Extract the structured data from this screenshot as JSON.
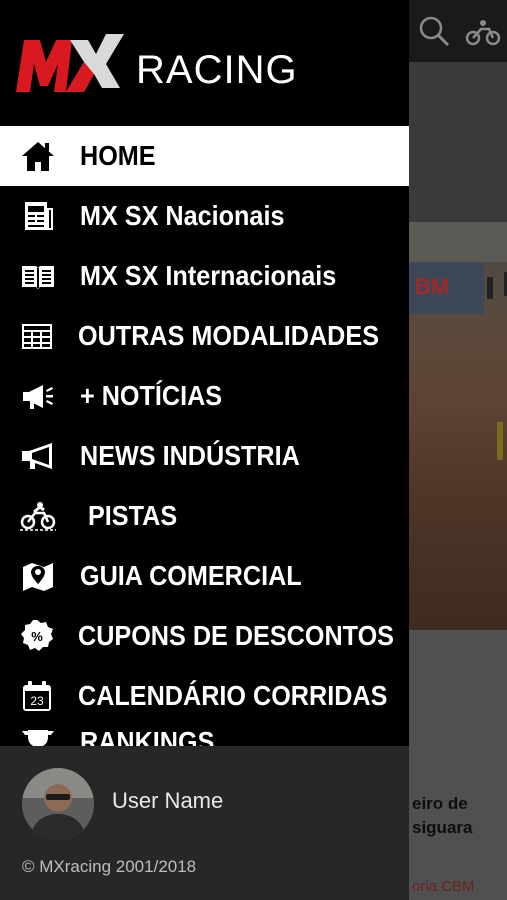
{
  "app": {
    "logo_text": "RACING",
    "logo_mark": "MX"
  },
  "background": {
    "headline": "eiro de\nsiguara",
    "category": "oria CBM",
    "board_text": "BM",
    "icons": [
      "search-icon",
      "motocross-bike-icon"
    ]
  },
  "menu": {
    "items": [
      {
        "label": "HOME",
        "icon": "home-icon",
        "active": true
      },
      {
        "label": "MX SX Nacionais",
        "icon": "newspaper-icon"
      },
      {
        "label": "MX SX Internacionais",
        "icon": "open-book-icon"
      },
      {
        "label": "OUTRAS MODALIDADES",
        "icon": "table-icon"
      },
      {
        "label": "+ NOTÍCIAS",
        "icon": "megaphone-icon"
      },
      {
        "label": "NEWS INDÚSTRIA",
        "icon": "megaphone-icon"
      },
      {
        "label": "PISTAS",
        "icon": "motocross-bike-icon"
      },
      {
        "label": "GUIA COMERCIAL",
        "icon": "map-pin-icon"
      },
      {
        "label": "CUPONS DE DESCONTOS",
        "icon": "discount-badge-icon"
      },
      {
        "label": "CALENDÁRIO CORRIDAS",
        "icon": "calendar-icon"
      },
      {
        "label": "RANKINGS",
        "icon": "trophy-icon"
      }
    ],
    "calendar_day": "23",
    "discount_symbol": "%"
  },
  "footer": {
    "user_name": "User Name",
    "copyright": "© MXracing 2001/2018"
  },
  "colors": {
    "brand_red": "#d8191f",
    "drawer_bg": "#000000",
    "footer_bg": "#272727",
    "active_bg": "#ffffff"
  }
}
